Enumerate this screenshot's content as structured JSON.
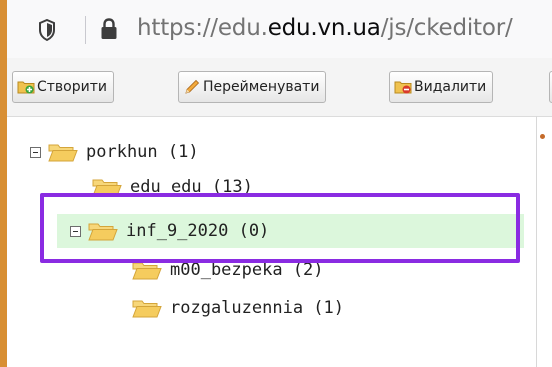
{
  "browser": {
    "url_prefix": "https://edu.",
    "url_domain": "edu.vn.ua",
    "url_suffix": "/js/ckeditor/"
  },
  "toolbar": {
    "create_label": "Створити",
    "rename_label": "Перейменувати",
    "delete_label": "Видалити"
  },
  "tree": {
    "root": {
      "label": "porkhun (1)"
    },
    "items": [
      {
        "label": "edu_edu (13)"
      },
      {
        "label": "inf_9_2020 (0)"
      },
      {
        "label": "m00_bezpeka (2)"
      },
      {
        "label": "rozgaluzennia (1)"
      }
    ]
  },
  "colors": {
    "highlight_border": "#8a2be2",
    "selected_bg": "#dcf7dc",
    "folder": "#f5cc5e"
  }
}
